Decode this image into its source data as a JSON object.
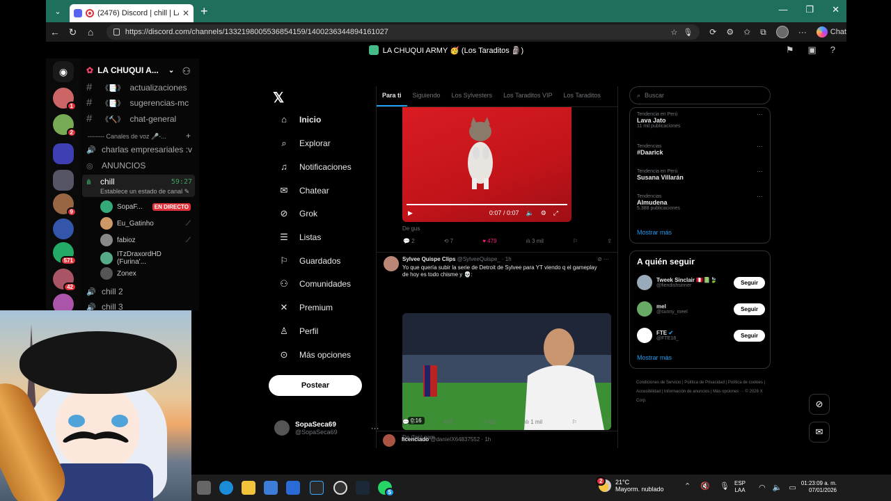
{
  "browser": {
    "tab_title": "(2476) Discord | chill | LA CHUQ",
    "url": "https://discord.com/channels/1332198005536854159/1400236344894161027",
    "copilot_label": "Chat"
  },
  "discord": {
    "window_title": "LA CHUQUI ARMY 🥳 (Los Taraditos 🗿)",
    "server_name": "LA CHUQUI A...",
    "rail_badges": [
      "1",
      "2",
      "9",
      "571",
      "42"
    ],
    "channels": [
      {
        "name": "actualizaciones",
        "emoji": "《📑》"
      },
      {
        "name": "sugerencias-mc",
        "emoji": "《📑》"
      },
      {
        "name": "chat-general",
        "emoji": "《🔨》"
      }
    ],
    "voice_category": "-------- Canales de voz 🎤-...",
    "voice_channels": {
      "charlas": "charlas empresariales :v",
      "anuncios": "ANUNCIOS",
      "chill": "chill",
      "chill_time": "59:27",
      "chill_status": "Establece un estado de canal",
      "chill2": "chill 2",
      "chill3": "chill 3"
    },
    "voice_users": [
      {
        "name": "SopaF...",
        "live": "EN DIRECTO"
      },
      {
        "name": "Eu_Gatinho"
      },
      {
        "name": "fabioz"
      },
      {
        "name": "ITzDraxordHD (Furina'..."
      },
      {
        "name": "Zonex"
      }
    ]
  },
  "x": {
    "nav": [
      "Inicio",
      "Explorar",
      "Notificaciones",
      "Chatear",
      "Grok",
      "Listas",
      "Guardados",
      "Comunidades",
      "Premium",
      "Perfil",
      "Más opciones"
    ],
    "post_button": "Postear",
    "me_name": "SopaSeca69",
    "me_handle": "@SopaSeca69",
    "tabs": [
      "Para ti",
      "Siguiendo",
      "Los Sylvesters",
      "Los Taraditos VIP",
      "Los Taraditos"
    ],
    "video1_time": "0:07 / 0:07",
    "video1_from": "De gus",
    "video1_stats": {
      "replies": "2",
      "reposts": "7",
      "likes": "479",
      "views": "3 mil"
    },
    "tweet2": {
      "name": "Sylvee Quispe Clips",
      "handle": "@SylveeQuispe_ · 1h",
      "text": "Yo que quería subir la serie de Detroit de Sylvee para YT viendo q el gameplay de hoy es todo chisme y 💀:",
      "video_time": "0:16",
      "from": "De (fan) gam",
      "replies": "3",
      "reposts": "3",
      "likes": "61",
      "views": "1 mil"
    },
    "tweet3": {
      "name": "licenciado",
      "handle": "@danieIX64837552 · 1h"
    },
    "search_placeholder": "Buscar",
    "trends": [
      {
        "context": "Tendencia en Perú",
        "name": "Lava Jato",
        "count": "11 mil publicaciones"
      },
      {
        "context": "Tendencias",
        "name": "#Daarick",
        "count": ""
      },
      {
        "context": "Tendencia en Perú",
        "name": "Susana Villarán",
        "count": ""
      },
      {
        "context": "Tendencias",
        "name": "Almudena",
        "count": "5.388 publicaciones"
      }
    ],
    "show_more": "Mostrar más",
    "who_to_follow_title": "A quién seguir",
    "follow_suggestions": [
      {
        "name": "Tweek Sinclair 🇵🇪📗🍃",
        "handle": "@fiendishsinner",
        "button": "Seguir"
      },
      {
        "name": "mel",
        "handle": "@sunny_meel",
        "button": "Seguir"
      },
      {
        "name": "FTE",
        "handle": "@FTE18_",
        "button": "Seguir"
      }
    ],
    "footer": "Condiciones de Servicio | Política de Privacidad | Política de cookies | Accesibilidad | Información de anuncios | Más opciones ··· © 2026 X Corp."
  },
  "taskbar": {
    "temperature": "21°C",
    "weather": "Mayorm. nublado",
    "weather_badge": "2",
    "whatsapp_badge": "5",
    "lang_top": "ESP",
    "lang_bottom": "LAA",
    "time": "01:23:09 a. m.",
    "date": "07/01/2026"
  }
}
